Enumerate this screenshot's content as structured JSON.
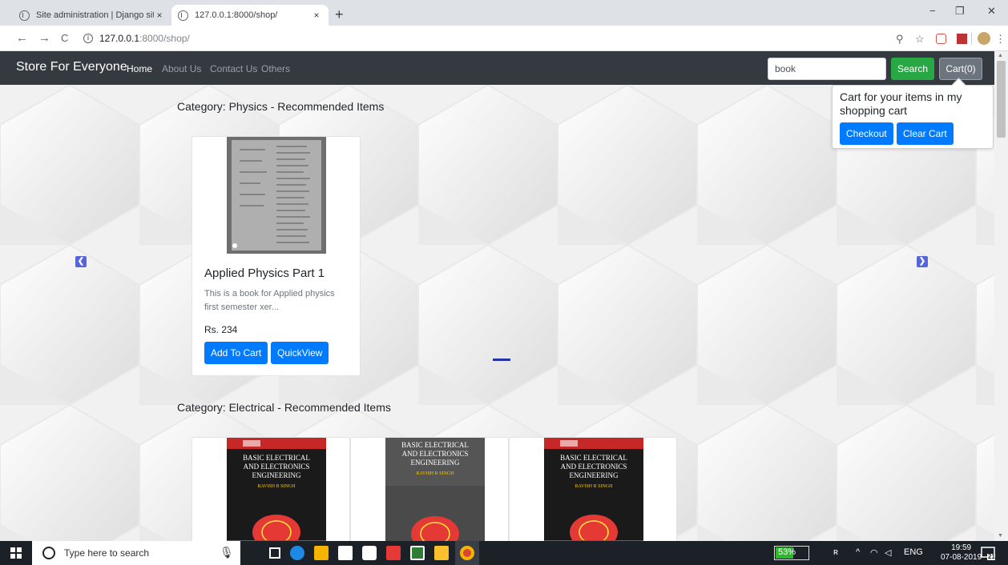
{
  "browser": {
    "tabs": [
      {
        "title": "Site administration | Django site admin",
        "close": "×"
      },
      {
        "title": "127.0.0.1:8000/shop/",
        "close": "×"
      }
    ],
    "new_tab": "+",
    "window_controls": {
      "minimize": "−",
      "maximize": "❐",
      "close": "✕"
    },
    "nav": {
      "back": "←",
      "forward": "→",
      "reload": "C"
    },
    "url_host": "127.0.0.1",
    "url_rest": ":8000/shop/",
    "toolbar": {
      "zoom": "⚲",
      "star": "☆",
      "menu": "⋮"
    }
  },
  "site": {
    "brand": "Store For Everyone",
    "nav_links": [
      "Home",
      "About Us",
      "Contact Us",
      "Others"
    ],
    "search_value": "book",
    "search_label": "Search",
    "cart_label": "Cart(0)",
    "popover": {
      "title": "Cart for your items in my shopping cart",
      "checkout_label": "Checkout",
      "clear_label": "Clear Cart"
    }
  },
  "categories": [
    {
      "heading": "Category: Physics - Recommended Items",
      "products": [
        {
          "title": "Applied Physics Part 1",
          "description": "This is a book for Applied physics first semester xer...",
          "price": "Rs. 234",
          "add_label": "Add To Cart",
          "quickview_label": "QuickView"
        }
      ]
    },
    {
      "heading": "Category: Electrical - Recommended Items",
      "products": [
        {
          "cover_lines": [
            "BASIC ELECTRICAL",
            "AND ELECTRONICS",
            "ENGINEERING"
          ],
          "author": "RAVISH R SINGH"
        },
        {
          "cover_lines": [
            "BASIC ELECTRICAL",
            "AND ELECTRONICS",
            "ENGINEERING"
          ],
          "author": "RAVISH R SINGH"
        },
        {
          "cover_lines": [
            "BASIC ELECTRICAL",
            "AND ELECTRONICS",
            "ENGINEERING"
          ],
          "author": "RAVISH R SINGH"
        }
      ]
    }
  ],
  "carousel": {
    "prev": "❮",
    "next": "❯"
  },
  "taskbar": {
    "search_placeholder": "Type here to search",
    "battery": "53%",
    "battery_level": 0.53,
    "language": "ENG",
    "time": "19:59",
    "date": "07-08-2019",
    "notifications": "21"
  },
  "colors": {
    "navbar": "#343a40",
    "primary": "#007bff",
    "success": "#28a745",
    "secondary": "#6c757d"
  }
}
